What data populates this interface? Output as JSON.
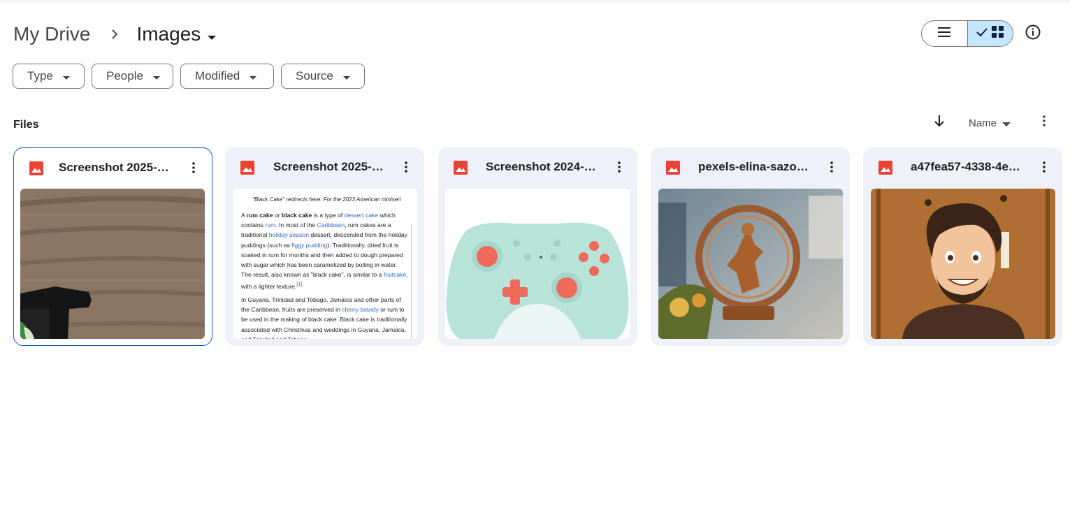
{
  "breadcrumb": {
    "root": "My Drive",
    "current": "Images"
  },
  "filters": [
    {
      "label": "Type"
    },
    {
      "label": "People"
    },
    {
      "label": "Modified"
    },
    {
      "label": "Source"
    }
  ],
  "files_section": {
    "label": "Files",
    "sort_label": "Name"
  },
  "files": [
    {
      "name": "Screenshot 2025-…",
      "icon": "image-icon",
      "selected": true
    },
    {
      "name": "Screenshot 2025-…",
      "icon": "image-icon",
      "selected": false
    },
    {
      "name": "Screenshot 2024-…",
      "icon": "image-icon",
      "selected": false
    },
    {
      "name": "pexels-elina-sazo…",
      "icon": "image-icon",
      "selected": false
    },
    {
      "name": "a47fea57-4338-4e…",
      "icon": "image-icon",
      "selected": false
    }
  ],
  "doc_thumbnail": {
    "note": "\"Black Cake\" redirects here. For the 2023 American miniseri",
    "p1": {
      "a1": "A ",
      "b1": "rum cake",
      "a2": " or ",
      "b2": "black cake",
      "a3": " is a type of ",
      "l1": "dessert cake",
      "a4": " which contains ",
      "l2": "rum",
      "a5": ". In most of the ",
      "l3": "Caribbean",
      "a6": ", rum cakes are a traditional ",
      "l4": "holiday season",
      "a7": " dessert, descended from the holiday puddings (such as ",
      "l5": "figgy pudding",
      "a8": "). Traditionally, dried fruit is soaked in rum for months and then added to dough prepared with sugar which has been caramelized by boiling in water. The result, also known as \"black cake\", is similar to a ",
      "l6": "fruitcake",
      "a9": ", with a lighter texture.",
      "ref": "[1]"
    },
    "p2": {
      "a1": "In Guyana, Trinidad and Tobago, Jamaica and other parts of the Caribbean, fruits are preserved in ",
      "l1": "cherry brandy",
      "a2": " or rum to be used in the making of black cake. Black cake is traditionally associated with Christmas and weddings in Guyana, Jamaica, and Trinidad and Tobago."
    }
  },
  "colors": {
    "accent": "#0b57d0",
    "selected_toggle": "#c2e7ff",
    "card_bg": "#eef1f8",
    "image_icon": "#ea4335"
  }
}
